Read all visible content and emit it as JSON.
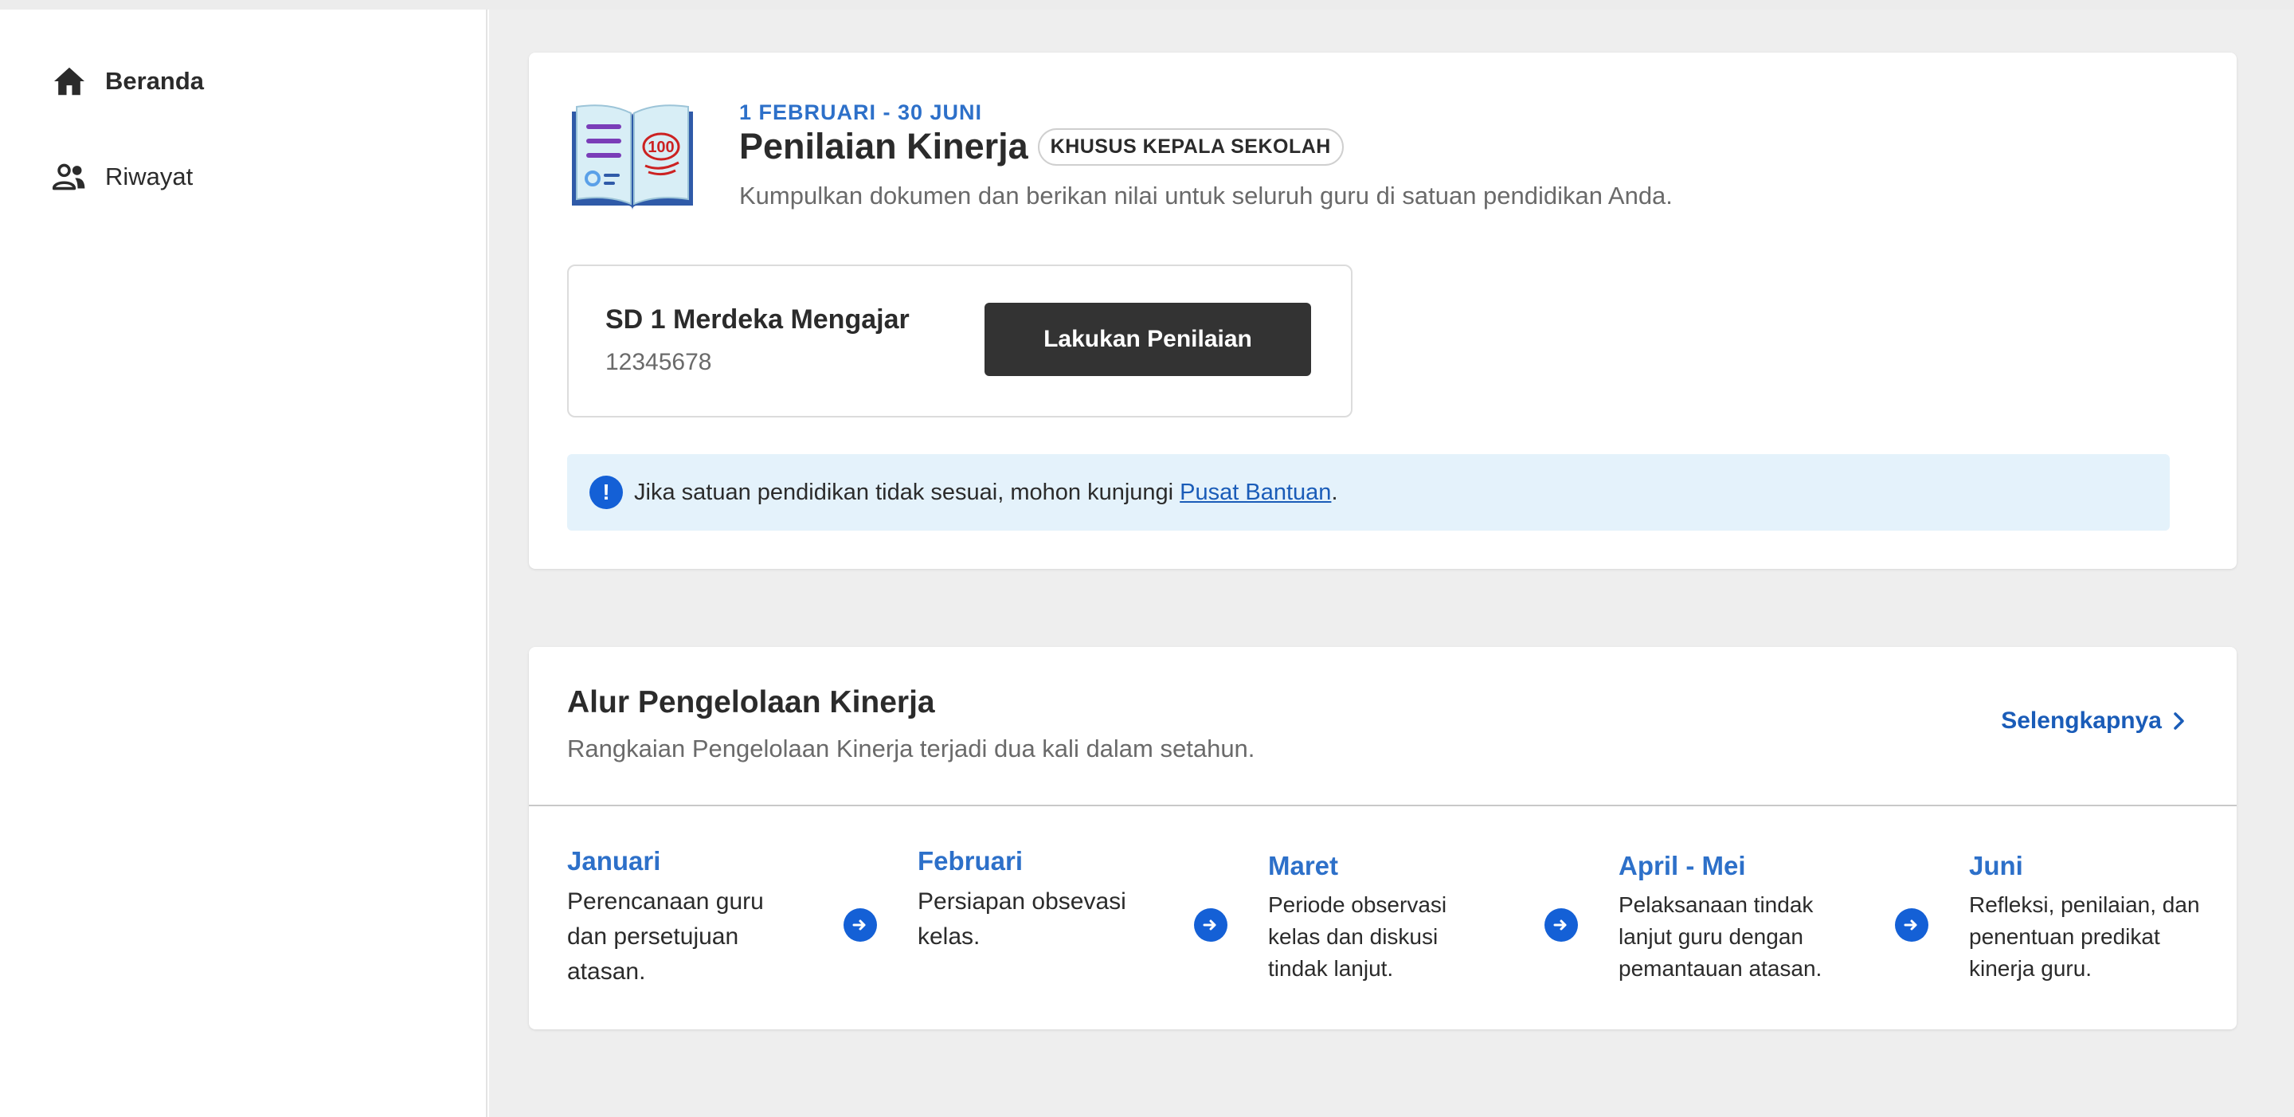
{
  "sidebar": {
    "items": [
      {
        "label": "Beranda",
        "icon": "home-icon",
        "active": true
      },
      {
        "label": "Riwayat",
        "icon": "people-icon",
        "active": false
      }
    ]
  },
  "assessment": {
    "period": "1 FEBRUARI - 30 JUNI",
    "title": "Penilaian Kinerja",
    "badge": "KHUSUS KEPALA SEKOLAH",
    "subtitle": "Kumpulkan dokumen dan berikan nilai untuk seluruh guru di satuan pendidikan Anda.",
    "illustration_text": "100",
    "school": {
      "name": "SD 1 Merdeka Mengajar",
      "id": "12345678",
      "button_label": "Lakukan Penilaian"
    },
    "info": {
      "text_before": "Jika satuan pendidikan tidak sesuai, mohon kunjungi ",
      "link_text": "Pusat Bantuan",
      "text_after": "."
    }
  },
  "flow": {
    "title": "Alur Pengelolaan Kinerja",
    "subtitle": "Rangkaian Pengelolaan Kinerja terjadi dua kali dalam setahun.",
    "more_label": "Selengkapnya",
    "steps": [
      {
        "month": "Januari",
        "desc": "Perencanaan guru dan persetujuan atasan."
      },
      {
        "month": "Februari",
        "desc": "Persiapan obsevasi kelas."
      },
      {
        "month": "Maret",
        "desc": "Periode observasi kelas dan diskusi tindak lanjut."
      },
      {
        "month": "April - Mei",
        "desc": "Pelaksanaan tindak lanjut guru dengan pemantauan atasan."
      },
      {
        "month": "Juni",
        "desc": "Refleksi, penilaian, dan penentuan predikat kinerja guru."
      }
    ]
  },
  "colors": {
    "accent_blue": "#2d70c9",
    "icon_blue": "#1460d6",
    "button_dark": "#333333",
    "info_bg": "#e4f2fb"
  }
}
